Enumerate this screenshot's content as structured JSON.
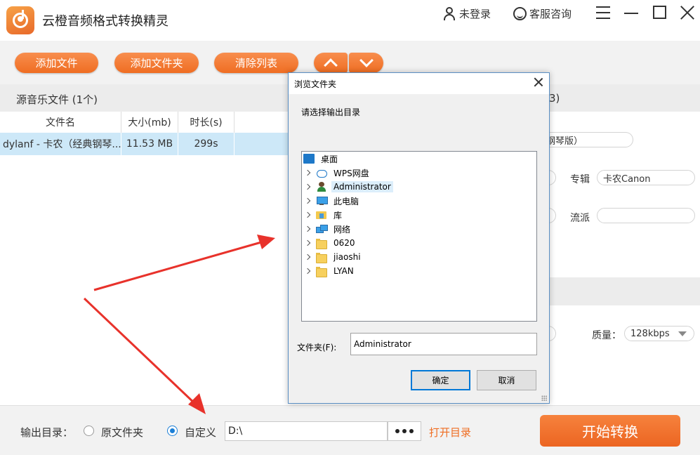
{
  "app": {
    "title": "云橙音频格式转换精灵"
  },
  "titlebar": {
    "login": "未登录",
    "service": "客服咨询"
  },
  "toolbar": {
    "add_file": "添加文件",
    "add_folder": "添加文件夹",
    "clear_list": "清除列表"
  },
  "list": {
    "header": "源音乐文件 (1个)",
    "right_header_fragment": "3)",
    "columns": [
      "文件名",
      "大小(mb)",
      "时长(s)"
    ],
    "rows": [
      {
        "name": "dylanf - 卡农（经典钢琴...",
        "size": "11.53 MB",
        "duration": "299s"
      }
    ]
  },
  "right_panel": {
    "title_fragment": "钢琴版）",
    "album_label": "专辑",
    "album_value": "卡农Canon",
    "genre_label": "流派",
    "genre_value": "",
    "quality_label": "质量：",
    "quality_value": "128kbps"
  },
  "bottom": {
    "output_label": "输出目录：",
    "option_original": "原文件夹",
    "option_custom": "自定义",
    "path": "D:\\",
    "open_dir": "打开目录",
    "start": "开始转换"
  },
  "dialog": {
    "title": "浏览文件夹",
    "prompt": "请选择输出目录",
    "tree": [
      {
        "label": "桌面",
        "icon": "desktop-icon"
      },
      {
        "label": "WPS网盘",
        "icon": "cloud-icon"
      },
      {
        "label": "Administrator",
        "icon": "user-icon",
        "selected": true
      },
      {
        "label": "此电脑",
        "icon": "computer-icon"
      },
      {
        "label": "库",
        "icon": "library-icon"
      },
      {
        "label": "网络",
        "icon": "network-icon"
      },
      {
        "label": "0620",
        "icon": "folder-icon"
      },
      {
        "label": "jiaoshi",
        "icon": "folder-icon"
      },
      {
        "label": "LYAN",
        "icon": "folder-icon"
      }
    ],
    "folder_label": "文件夹(F):",
    "folder_value": "Administrator",
    "ok": "确定",
    "cancel": "取消"
  },
  "colors": {
    "accent": "#ef6d22",
    "selection": "#cde8f8",
    "arrow": "#e8322b"
  }
}
